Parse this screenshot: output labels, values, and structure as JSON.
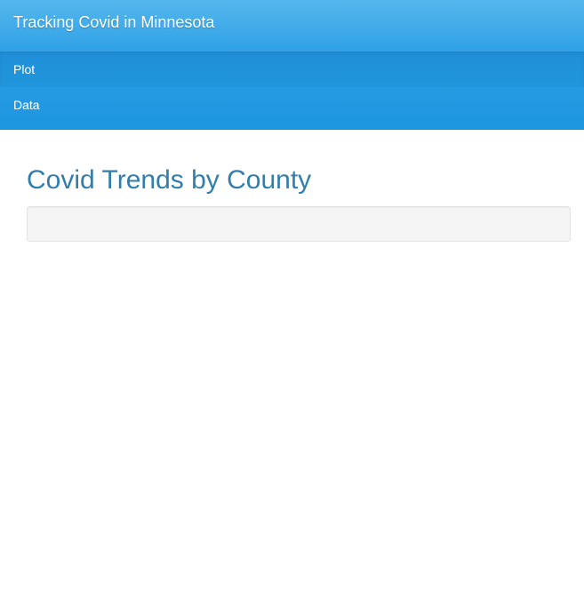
{
  "navbar": {
    "brand": "Tracking Covid in Minnesota",
    "items": [
      {
        "label": "Plot",
        "active": true
      },
      {
        "label": "Data",
        "active": false
      }
    ]
  },
  "main": {
    "title": "Covid Trends by County"
  },
  "colors": {
    "navbar_top": "#55b6ec",
    "navbar_bottom": "#1e95e0",
    "active_item": "#1f8fd8",
    "title": "#317eac",
    "well_background": "#f5f5f5",
    "well_border": "#e3e3e3"
  }
}
